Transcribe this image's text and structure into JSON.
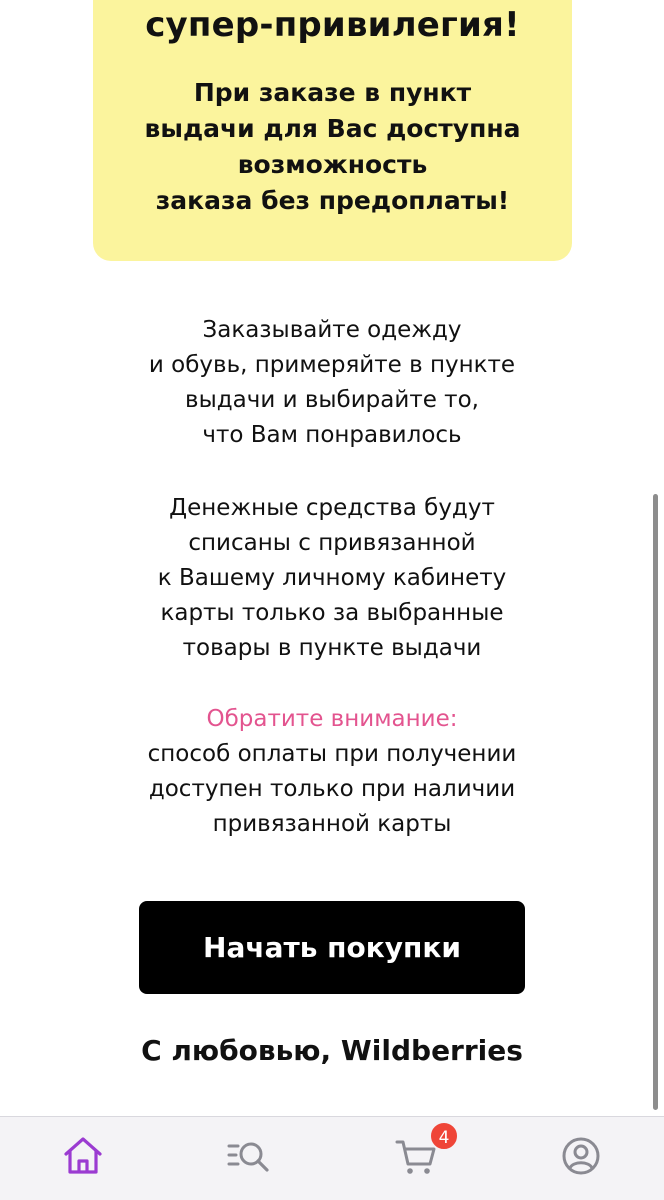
{
  "promo": {
    "headline": "супер-привилегия!",
    "lines": [
      "При заказе в пункт",
      "выдачи для Вас доступна",
      "возможность",
      "заказа без предоплаты!"
    ]
  },
  "info": {
    "paragraph1": [
      "Заказывайте одежду",
      "и обувь, примеряйте в пункте",
      "выдачи и выбирайте то,",
      "что Вам понравилось"
    ],
    "paragraph2": [
      "Денежные средства будут",
      "списаны с привязанной",
      "к Вашему личному кабинету",
      "карты только за выбранные",
      "товары в пункте выдачи"
    ],
    "notice_label": "Обратите внимание:",
    "notice_lines": [
      "способ оплаты при получении",
      "доступен только при наличии",
      "привязанной карты"
    ]
  },
  "cta": {
    "label": "Начать покупки"
  },
  "signature": "С любовью, Wildberries",
  "tabbar": {
    "items": [
      {
        "name": "home",
        "icon": "home-icon",
        "active": true
      },
      {
        "name": "catalog",
        "icon": "catalog-search-icon",
        "active": false
      },
      {
        "name": "cart",
        "icon": "cart-icon",
        "active": false
      },
      {
        "name": "profile",
        "icon": "profile-icon",
        "active": false
      }
    ],
    "cart_badge": "4"
  },
  "colors": {
    "promo_background": "#fbf49d",
    "notice": "#e3548f",
    "active_tab": "#9b3bd1",
    "inactive_tab": "#8a8a92",
    "badge": "#ef4538",
    "button": "#000000"
  }
}
